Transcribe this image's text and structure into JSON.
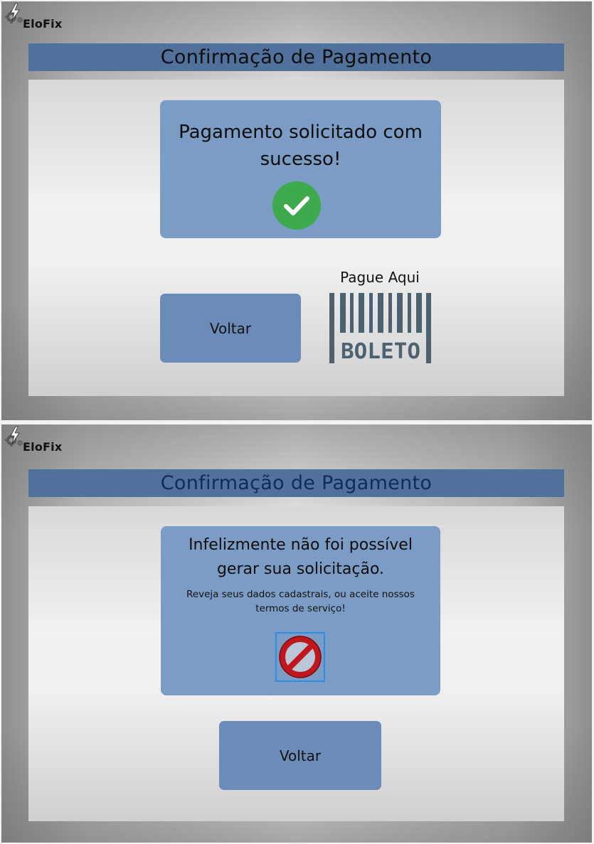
{
  "colors": {
    "header_bar": "#4f719b",
    "card": "#7b9cc5",
    "button": "#6b8cb8",
    "success_green": "#3daa4e",
    "forbidden_red": "#c0171e",
    "boleto_gray": "#4d6270"
  },
  "screens": [
    {
      "logo": {
        "text": "EloFix",
        "icon": "lightning-gear-icon"
      },
      "header": {
        "title": "Confirmação de Pagamento"
      },
      "message": {
        "title": "Pagamento solicitado com sucesso!",
        "icon": "check-circle-icon"
      },
      "back_button": {
        "label": "Voltar"
      },
      "payment": {
        "label": "Pague Aqui",
        "boleto_text": "BOLETO",
        "icon": "barcode-boleto-icon"
      }
    },
    {
      "logo": {
        "text": "EloFix",
        "icon": "lightning-gear-icon"
      },
      "header": {
        "title": "Confirmação de Pagamento"
      },
      "message": {
        "title": "Infelizmente não foi possível gerar sua solicitação.",
        "subtitle": "Reveja seus dados cadastrais, ou aceite nossos termos de serviço!",
        "icon": "forbidden-icon"
      },
      "back_button": {
        "label": "Voltar"
      }
    }
  ]
}
